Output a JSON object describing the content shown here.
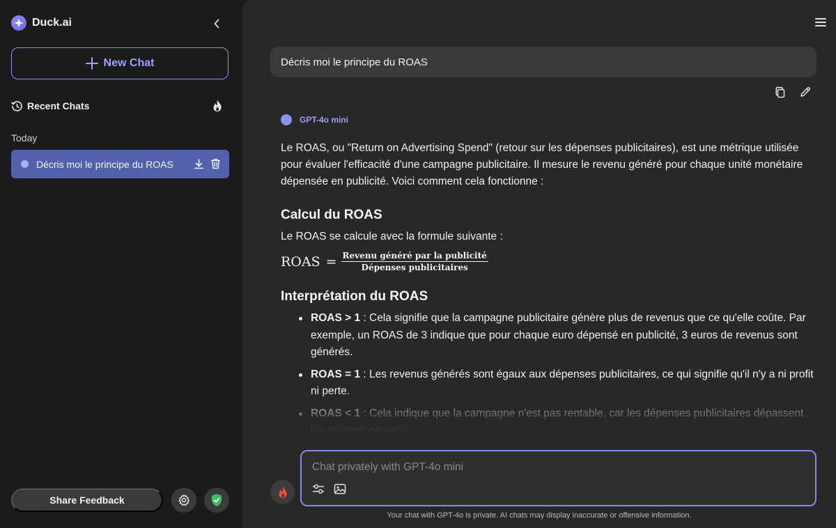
{
  "sidebar": {
    "brand": "Duck.ai",
    "new_chat_label": "New Chat",
    "recent_chats_label": "Recent Chats",
    "section_today": "Today",
    "chats": [
      {
        "title": "Décris moi le principe du ROAS",
        "active": true
      }
    ],
    "share_feedback_label": "Share Feedback"
  },
  "conversation": {
    "user_message": "Décris moi le principe du ROAS",
    "model_name": "GPT-4o mini",
    "intro": "Le ROAS, ou \"Return on Advertising Spend\" (retour sur les dépenses publicitaires), est une métrique utilisée pour évaluer l'efficacité d'une campagne publicitaire. Il mesure le revenu généré pour chaque unité monétaire dépensée en publicité. Voici comment cela fonctionne :",
    "heading_calc": "Calcul du ROAS",
    "formula_intro": "Le ROAS se calcule avec la formule suivante :",
    "formula": {
      "lhs": "ROAS",
      "eq": "=",
      "numerator": "Revenu généré par la publicité",
      "denominator": "Dépenses publicitaires"
    },
    "heading_interp": "Interprétation du ROAS",
    "bullets": [
      {
        "label": "ROAS > 1",
        "text": " : Cela signifie que la campagne publicitaire génère plus de revenus que ce qu'elle coûte. Par exemple, un ROAS de 3 indique que pour chaque euro dépensé en publicité, 3 euros de revenus sont générés."
      },
      {
        "label": "ROAS = 1",
        "text": " : Les revenus générés sont égaux aux dépenses publicitaires, ce qui signifie qu'il n'y a ni profit ni perte."
      },
      {
        "label": "ROAS < 1",
        "text": " : Cela indique que la campagne n'est pas rentable, car les dépenses publicitaires dépassent les revenus générés."
      }
    ]
  },
  "composer": {
    "placeholder": "Chat privately with GPT-4o mini",
    "value": ""
  },
  "footer": {
    "disclaimer": "Your chat with GPT-4o is private. AI chats may display inaccurate or offensive information."
  },
  "colors": {
    "accent": "#8d90f0",
    "active_chat": "#5361ad",
    "fire": "#e8503a",
    "shield": "#3fb85f"
  },
  "icons": [
    "duck-ai-logo",
    "chevron-left-icon",
    "plus-icon",
    "history-icon",
    "fire-icon",
    "download-icon",
    "trash-icon",
    "gear-icon",
    "shield-icon",
    "menu-icon",
    "copy-icon",
    "edit-icon",
    "sliders-icon",
    "image-icon"
  ]
}
